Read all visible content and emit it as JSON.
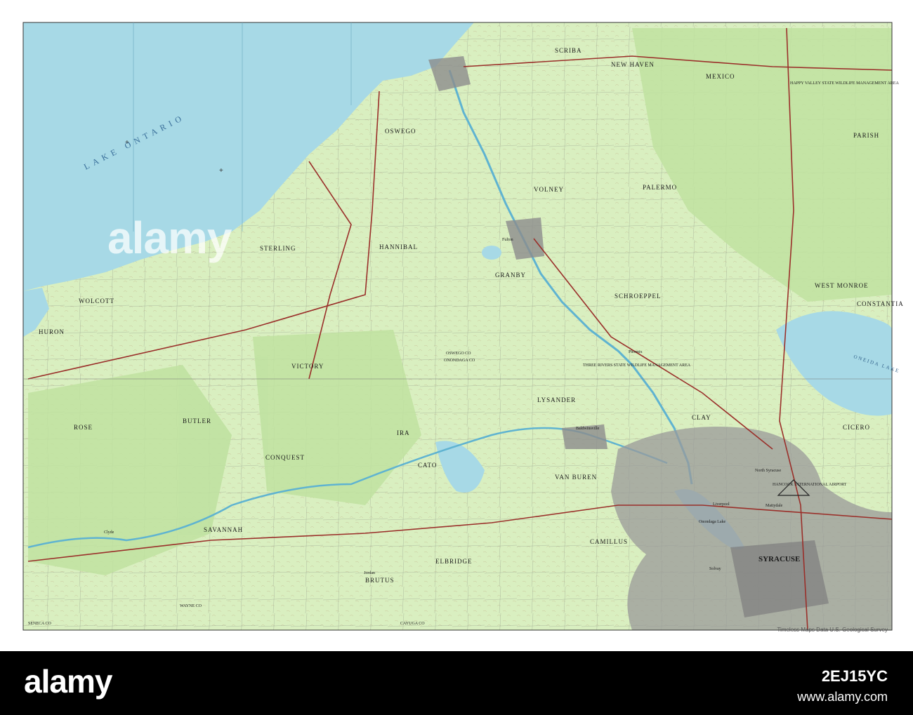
{
  "map": {
    "lake_label": "LAKE ONTARIO",
    "credit": "Timeless Maps Data U.S. Geological Survey",
    "places": {
      "syracuse": "SYRACUSE",
      "north_syracuse": "North Syracuse",
      "fulton": "Fulton",
      "volney": "VOLNEY",
      "palermo": "PALERMO",
      "scriba": "SCRIBA",
      "new_haven": "NEW HAVEN",
      "mexico": "MEXICO",
      "parish": "PARISH",
      "oswego_town": "OSWEGO",
      "granby": "GRANBY",
      "hannibal": "HANNIBAL",
      "sterling": "STERLING",
      "wolcott": "WOLCOTT",
      "huron": "HURON",
      "victory": "VICTORY",
      "lysander": "LYSANDER",
      "schroeppel": "SCHROEPPEL",
      "west_monroe": "WEST MONROE",
      "constantia": "CONSTANTIA",
      "cicero": "CICERO",
      "clay": "CLAY",
      "van_buren": "VAN BUREN",
      "cato": "CATO",
      "conquest": "CONQUEST",
      "ira": "IRA",
      "rose": "ROSE",
      "butler": "BUTLER",
      "savannah": "SAVANNAH",
      "elbridge": "ELBRIDGE",
      "brutus": "BRUTUS",
      "camillus": "CAMILLUS",
      "baldwinsville": "Baldwinsville",
      "phoenix": "Phoenix",
      "liverpool": "Liverpool",
      "mattydale": "Mattydale",
      "solvay": "Solvay",
      "jordan": "Jordan",
      "clyde": "Clyde",
      "oneida_lake": "ONEIDA LAKE",
      "onondaga_lake": "Onondaga Lake",
      "oswego_co": "OSWEGO CO",
      "onondaga_co": "ONONDAGA CO",
      "cayuga_co": "CAYUGA CO",
      "wayne_co": "WAYNE CO",
      "seneca_co": "SENECA CO",
      "airport": "HANCOCK INTERNATIONAL AIRPORT",
      "three_rivers": "THREE RIVERS STATE WILDLIFE MANAGEMENT AREA",
      "happy_valley": "HAPPY VALLEY STATE WILDLIFE MANAGEMENT AREA"
    }
  },
  "footer": {
    "logo": "alamy",
    "image_id": "2EJ15YC",
    "url": "www.alamy.com"
  },
  "watermark": "alamy",
  "colors": {
    "water": "#a7d9e6",
    "land": "#d9efc0",
    "woods": "#bfe2a0",
    "urban": "#9a9a9a",
    "roads": "#9a2f2a",
    "footer": "#000000"
  }
}
